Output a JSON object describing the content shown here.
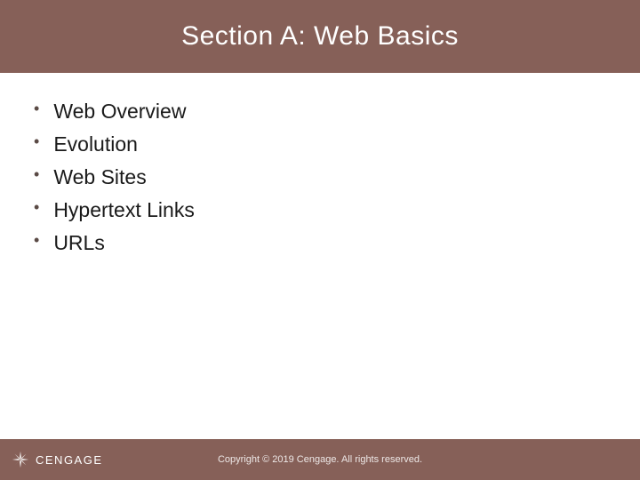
{
  "header": {
    "title": "Section A: Web Basics"
  },
  "bullets": {
    "items": [
      {
        "text": "Web Overview"
      },
      {
        "text": "Evolution"
      },
      {
        "text": "Web Sites"
      },
      {
        "text": "Hypertext Links"
      },
      {
        "text": "URLs"
      }
    ]
  },
  "footer": {
    "brand": "CENGAGE",
    "copyright": "Copyright © 2019 Cengage. All rights reserved."
  }
}
